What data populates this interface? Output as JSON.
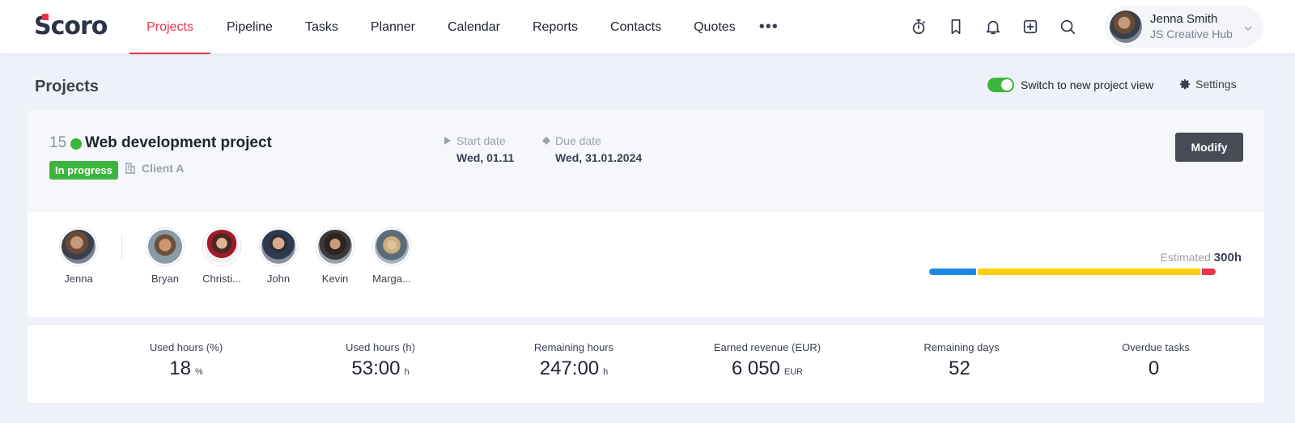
{
  "app": {
    "logo": "Scoro"
  },
  "nav": {
    "items": [
      {
        "label": "Projects",
        "active": true
      },
      {
        "label": "Pipeline"
      },
      {
        "label": "Tasks"
      },
      {
        "label": "Planner"
      },
      {
        "label": "Calendar"
      },
      {
        "label": "Reports"
      },
      {
        "label": "Contacts"
      },
      {
        "label": "Quotes"
      }
    ],
    "more_label": "•••",
    "icons": [
      "timer-icon",
      "bookmark-icon",
      "bell-icon",
      "add-icon",
      "search-icon"
    ]
  },
  "user": {
    "name": "Jenna Smith",
    "org": "JS Creative Hub"
  },
  "page": {
    "title": "Projects",
    "toggle_label": "Switch to new project view",
    "toggle_on": true,
    "settings_label": "Settings"
  },
  "project": {
    "number": "15",
    "name": "Web development project",
    "status": "In progress",
    "client": "Client A",
    "start_label": "Start date",
    "start_value": "Wed, 01.11",
    "due_label": "Due date",
    "due_value": "Wed, 31.01.2024",
    "modify_label": "Modify",
    "members": [
      {
        "name": "Jenna"
      },
      {
        "name": "Bryan"
      },
      {
        "name": "Christi..."
      },
      {
        "name": "John"
      },
      {
        "name": "Kevin"
      },
      {
        "name": "Marga..."
      }
    ],
    "estimate_label": "Estimated",
    "estimate_value": "300h",
    "estimate_bar": [
      {
        "color": "#1e88e5",
        "fraction": 0.165
      },
      {
        "color": "#fcd00c",
        "fraction": 0.785
      },
      {
        "color": "#e8344e",
        "fraction": 0.05
      }
    ]
  },
  "stats": [
    {
      "label": "Used hours (%)",
      "value": "18",
      "unit": "%"
    },
    {
      "label": "Used hours (h)",
      "value": "53:00",
      "unit": "h"
    },
    {
      "label": "Remaining hours",
      "value": "247:00",
      "unit": "h"
    },
    {
      "label": "Earned revenue (EUR)",
      "value": "6 050",
      "unit": "EUR"
    },
    {
      "label": "Remaining days",
      "value": "52",
      "unit": ""
    },
    {
      "label": "Overdue tasks",
      "value": "0",
      "unit": ""
    }
  ],
  "colors": {
    "accent": "#e8344e",
    "status_green": "#3db53c",
    "button_dark": "#464b55"
  }
}
